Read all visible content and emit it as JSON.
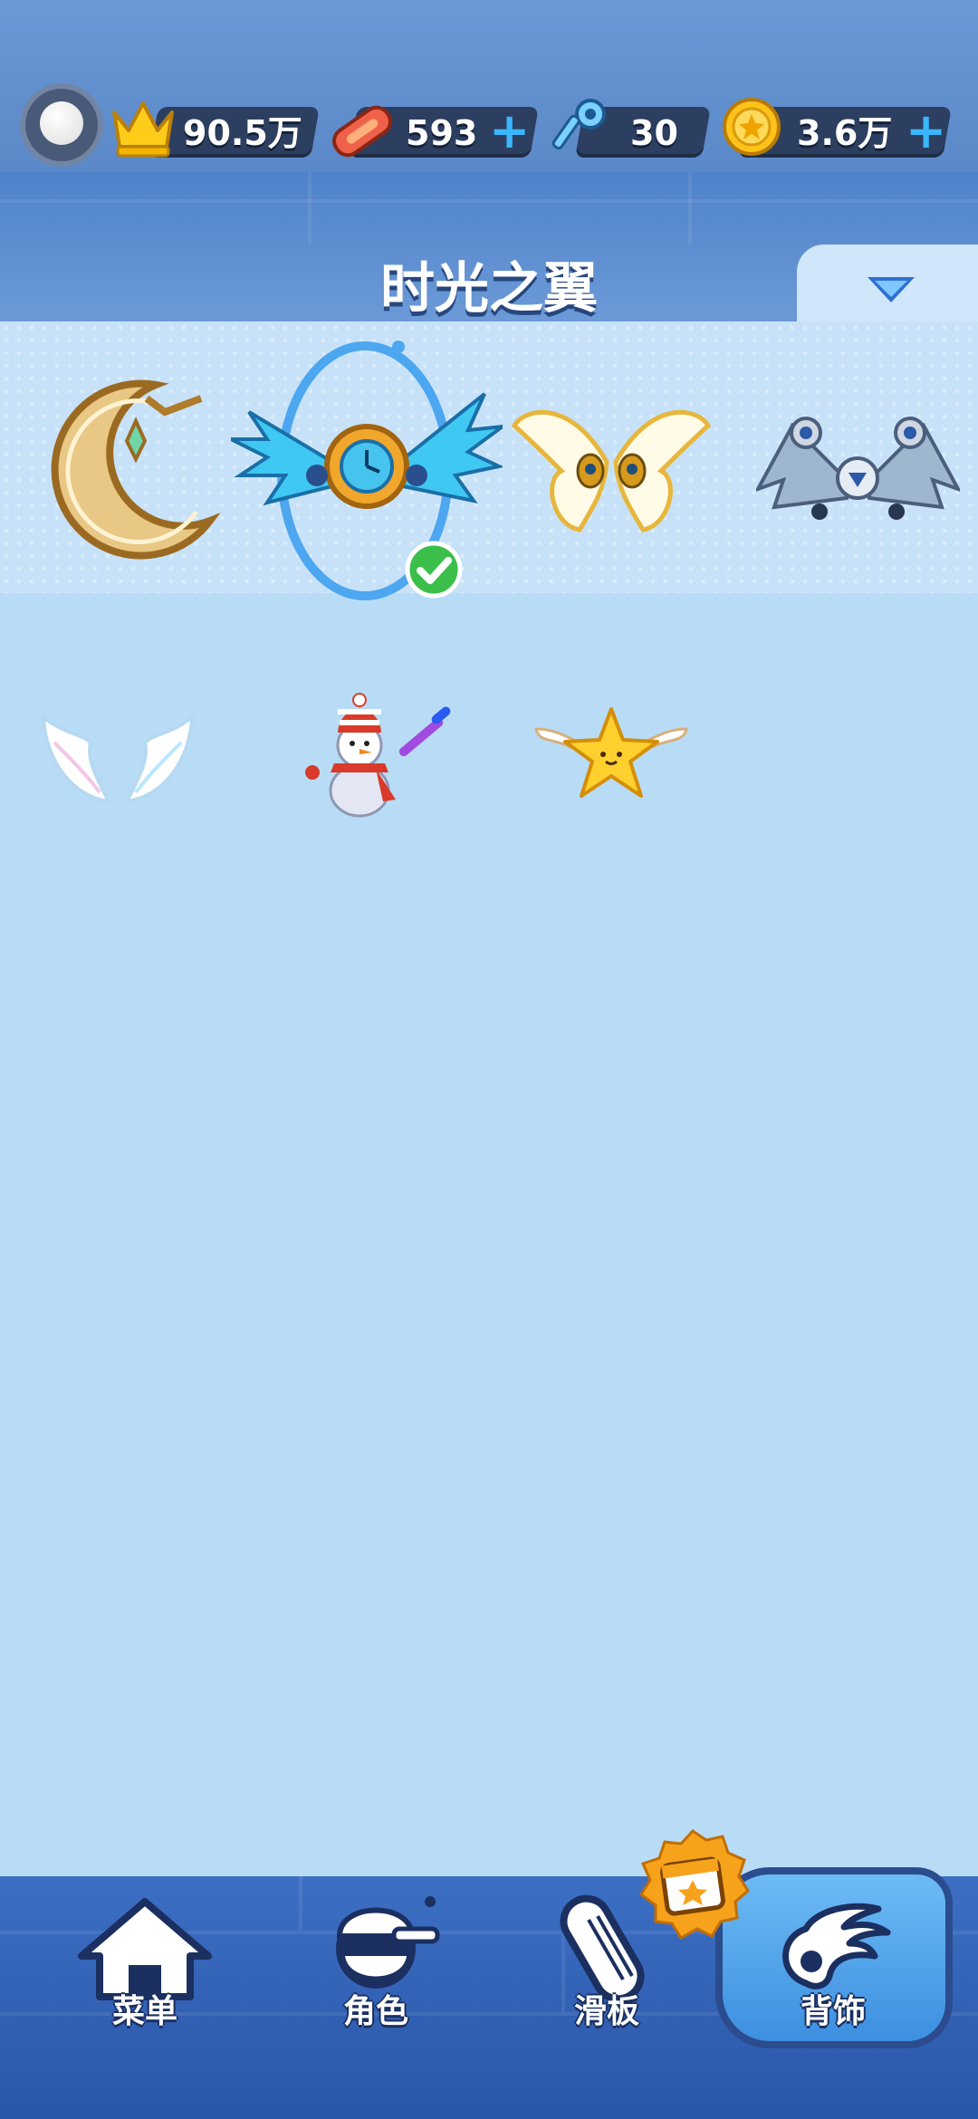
{
  "top_bar": {
    "trophy": "90.5万",
    "skateboard_tickets": "593",
    "keys": "30",
    "coins": "3.6万"
  },
  "category": {
    "title": "时光之翼"
  },
  "items": [
    {
      "icon": "golden-moon-wings-icon",
      "equipped": false
    },
    {
      "icon": "time-gear-wings-icon",
      "equipped": true
    },
    {
      "icon": "golden-butterfly-wings-icon",
      "equipped": false
    },
    {
      "icon": "mech-wings-icon",
      "equipped": false
    },
    {
      "icon": "white-angel-wings-icon",
      "equipped": false
    },
    {
      "icon": "snowman-icon",
      "equipped": false
    },
    {
      "icon": "winged-star-icon",
      "equipped": false
    }
  ],
  "bottom_nav": {
    "menu": "菜单",
    "character": "角色",
    "skateboard": "滑板",
    "backpack": "背饰",
    "active": "背饰"
  },
  "colors": {
    "accent": "#3ab7ff",
    "background": "#b9dcf6",
    "nav": "#2a56a8"
  }
}
